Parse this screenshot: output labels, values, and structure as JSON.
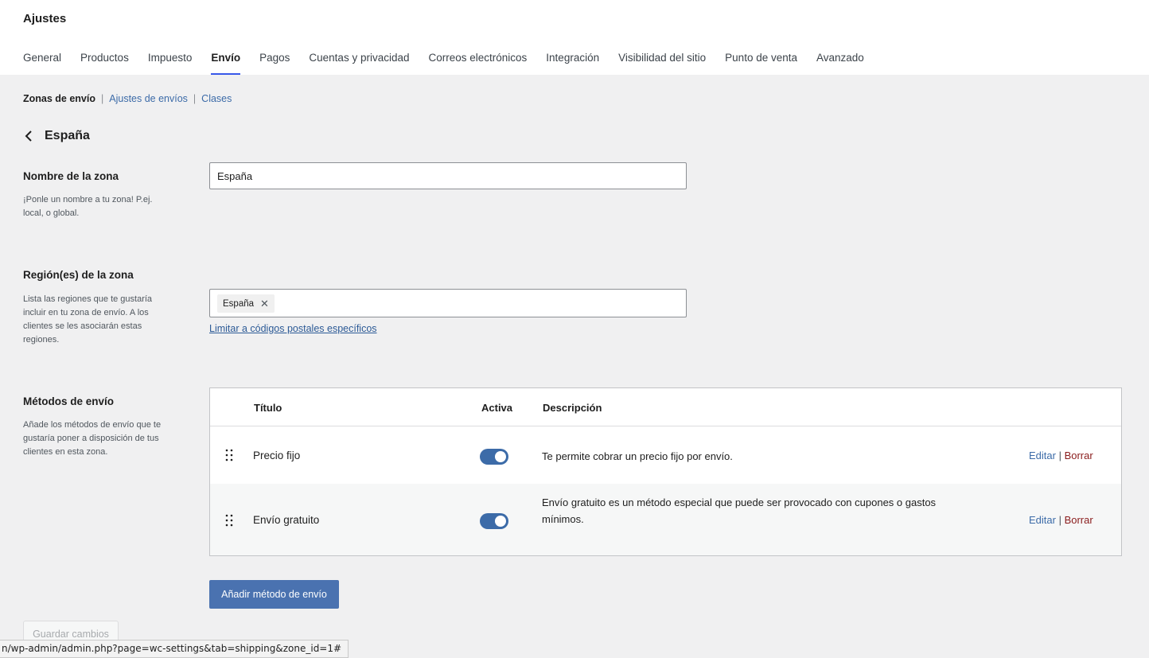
{
  "header": {
    "title": "Ajustes",
    "tabs": [
      {
        "label": "General"
      },
      {
        "label": "Productos"
      },
      {
        "label": "Impuesto"
      },
      {
        "label": "Envío",
        "active": true
      },
      {
        "label": "Pagos"
      },
      {
        "label": "Cuentas y privacidad"
      },
      {
        "label": "Correos electrónicos"
      },
      {
        "label": "Integración"
      },
      {
        "label": "Visibilidad del sitio"
      },
      {
        "label": "Punto de venta"
      },
      {
        "label": "Avanzado"
      }
    ]
  },
  "subnav": {
    "current": "Zonas de envío",
    "links": [
      "Ajustes de envíos",
      "Clases"
    ]
  },
  "zone": {
    "title": "España",
    "name_field": {
      "label": "Nombre de la zona",
      "help": "¡Ponle un nombre a tu zona! P.ej. local, o global.",
      "value": "España"
    },
    "regions_field": {
      "label": "Región(es) de la zona",
      "help": "Lista las regiones que te gustaría incluir en tu zona de envío. A los clientes se les asociarán estas regiones.",
      "chips": [
        "España"
      ],
      "postal_link": "Limitar a códigos postales específicos"
    },
    "methods": {
      "label": "Métodos de envío",
      "help": "Añade los métodos de envío que te gustaría poner a disposición de tus clientes en esta zona.",
      "columns": {
        "title": "Título",
        "active": "Activa",
        "description": "Descripción"
      },
      "rows": [
        {
          "title": "Precio fijo",
          "active": true,
          "description": "Te permite cobrar un precio fijo por envío.",
          "edit": "Editar",
          "delete": "Borrar"
        },
        {
          "title": "Envío gratuito",
          "active": true,
          "description": "Envío gratuito es un método especial que puede ser provocado con cupones o gastos mínimos.",
          "edit": "Editar",
          "delete": "Borrar"
        }
      ],
      "add_button": "Añadir método de envío"
    }
  },
  "save_button": "Guardar cambios",
  "status_url": "n/wp-admin/admin.php?page=wc-settings&tab=shipping&zone_id=1#",
  "colors": {
    "accent": "#3858e9",
    "button": "#4a72b0",
    "toggle": "#3c6ba8",
    "delete": "#8a1c1c"
  }
}
